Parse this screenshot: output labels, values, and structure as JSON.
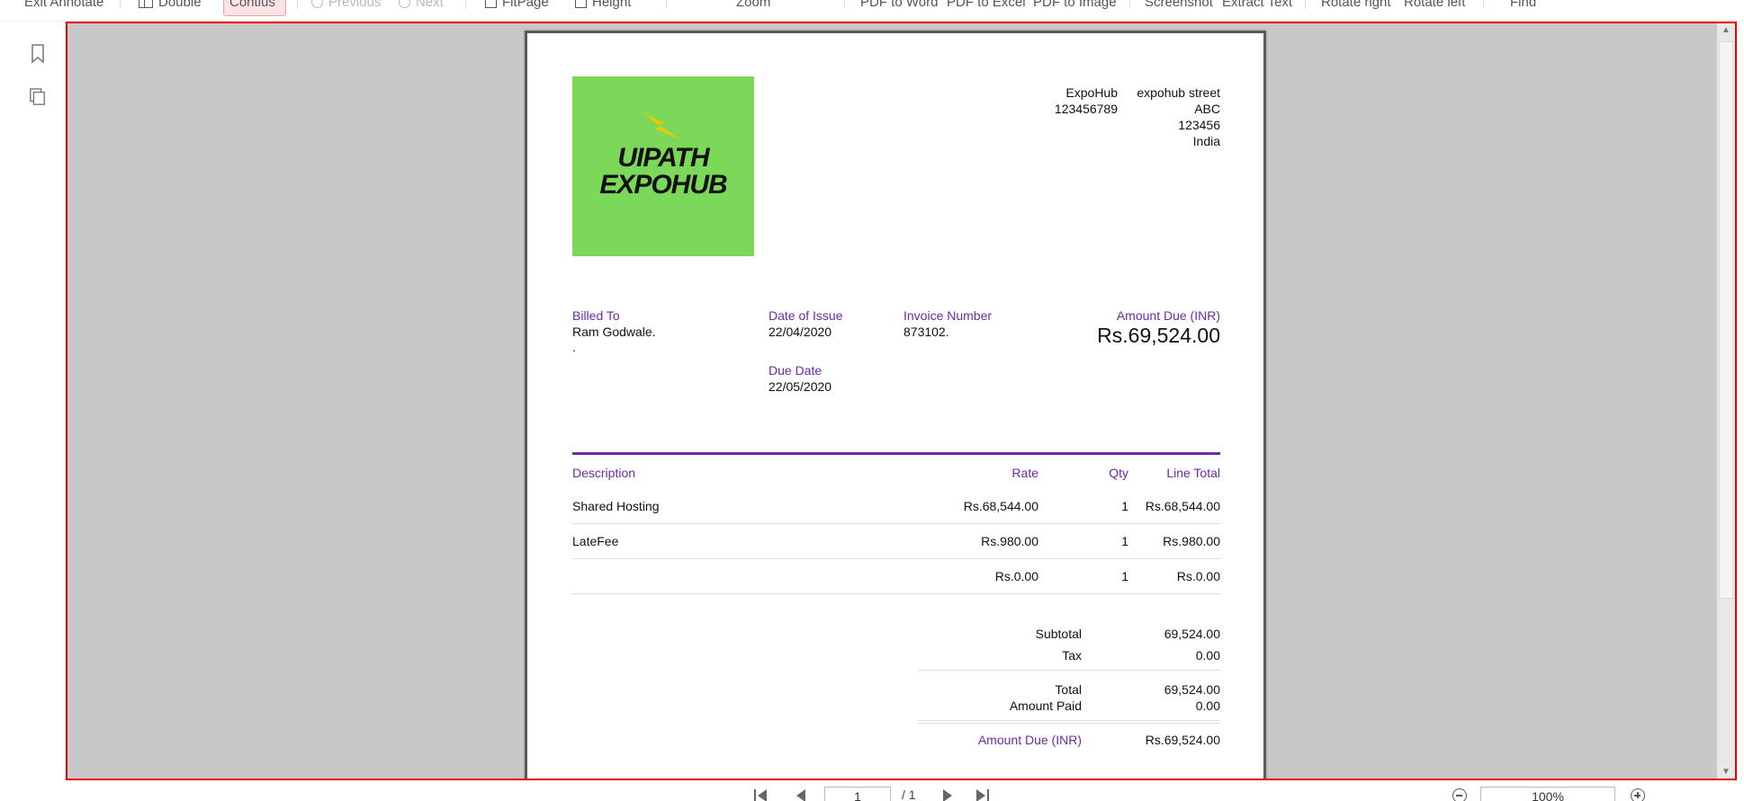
{
  "toolbar": {
    "exit_annotate": "Exit Annotate",
    "double": "Double",
    "contius": "Contius",
    "previous": "Previous",
    "next": "Next",
    "fitpage": "FitPage",
    "height": "Height",
    "zoom": "Zoom",
    "pdf_to_word": "PDF to Word",
    "pdf_to_excel": "PDF to Excel",
    "pdf_to_image": "PDF to Image",
    "screenshot": "Screenshot",
    "extract_text": "Extract Text",
    "rotate_right": "Rotate right",
    "rotate_left": "Rotate left",
    "find": "Find"
  },
  "sidebar": {
    "icons": [
      "bookmark-icon",
      "pages-icon"
    ]
  },
  "invoice": {
    "logo": {
      "line1": "UIPATH",
      "line2": "EXPOHUB",
      "bg_color": "#7bd858"
    },
    "company": {
      "name": "ExpoHub",
      "phone": "123456789",
      "street": "expohub street",
      "city": "ABC",
      "zip": "123456",
      "country": "India"
    },
    "billed_to_label": "Billed To",
    "billed_to_name": "Ram Godwale.",
    "billed_to_line2": ".",
    "date_of_issue_label": "Date of Issue",
    "date_of_issue": "22/04/2020",
    "due_date_label": "Due Date",
    "due_date": "22/05/2020",
    "invoice_number_label": "Invoice Number",
    "invoice_number": "873102.",
    "amount_due_label": "Amount Due (INR)",
    "amount_due": "Rs.69,524.00",
    "columns": {
      "description": "Description",
      "rate": "Rate",
      "qty": "Qty",
      "line_total": "Line Total"
    },
    "items": [
      {
        "description": "Shared Hosting",
        "rate": "Rs.68,544.00",
        "qty": "1",
        "total": "Rs.68,544.00"
      },
      {
        "description": "LateFee",
        "rate": "Rs.980.00",
        "qty": "1",
        "total": "Rs.980.00"
      },
      {
        "description": "",
        "rate": "Rs.0.00",
        "qty": "1",
        "total": "Rs.0.00"
      }
    ],
    "subtotal_label": "Subtotal",
    "subtotal": "69,524.00",
    "tax_label": "Tax",
    "tax": "0.00",
    "total_label": "Total",
    "total": "69,524.00",
    "amount_paid_label": "Amount Paid",
    "amount_paid": "0.00",
    "amount_due_footer_label": "Amount Due (INR)",
    "amount_due_footer": "Rs.69,524.00"
  },
  "pager": {
    "current_page": "1",
    "total_pages": "/ 1",
    "zoom_level": "100%"
  },
  "colors": {
    "accent": "#6b2aa8",
    "highlight_border": "#e60000",
    "viewer_bg": "#c8c8c8"
  }
}
